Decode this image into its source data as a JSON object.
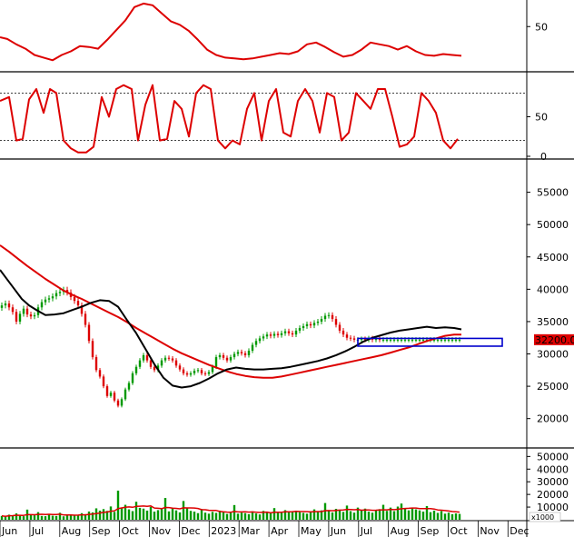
{
  "chart_data": {
    "type": "line",
    "colors": {
      "adx": "#dd0000",
      "stoch": "#dd0000",
      "ma_long": "#dd0000",
      "ma_short": "#000000",
      "up_candle": "#009900",
      "down_candle": "#dd0000",
      "volume": "#009900",
      "support_box": "#0000cc",
      "price_tag_bg": "#dd0000"
    },
    "x_labels": [
      "Jun",
      "Jul",
      "Aug",
      "Sep",
      "Oct",
      "Nov",
      "Dec",
      "2023",
      "Mar",
      "Apr",
      "May",
      "Jun",
      "Jul",
      "Aug",
      "Sep",
      "Oct",
      "Nov",
      "Dec"
    ],
    "indicator_panel": {
      "yticks": [
        50
      ],
      "ylim": [
        0,
        80
      ],
      "x": [
        0,
        8,
        18,
        28,
        38,
        48,
        58,
        68,
        78,
        88,
        98,
        108,
        118,
        128,
        138,
        148,
        158,
        168,
        178,
        188,
        198,
        208,
        218,
        228,
        238,
        248,
        258,
        268,
        278,
        288,
        298,
        308,
        318,
        328,
        338,
        348,
        358,
        368,
        378,
        388,
        398,
        408,
        418,
        428,
        438,
        448,
        458,
        468,
        478,
        488,
        498,
        508
      ],
      "values": [
        38,
        36,
        30,
        25,
        18,
        15,
        12,
        18,
        22,
        28,
        27,
        25,
        35,
        46,
        57,
        72,
        76,
        74,
        65,
        56,
        52,
        45,
        35,
        24,
        18,
        15,
        14,
        13,
        14,
        16,
        18,
        20,
        19,
        22,
        30,
        32,
        27,
        21,
        16,
        18,
        24,
        32,
        30,
        28,
        24,
        28,
        22,
        18,
        17,
        19,
        18,
        17
      ]
    },
    "stochastic_panel": {
      "yticks": [
        0,
        50
      ],
      "ylim": [
        0,
        100
      ],
      "levels": [
        20,
        80
      ],
      "x": [
        0,
        10,
        18,
        25,
        32,
        40,
        48,
        55,
        62,
        70,
        78,
        86,
        95,
        103,
        112,
        120,
        128,
        136,
        145,
        152,
        160,
        168,
        176,
        184,
        192,
        200,
        208,
        216,
        224,
        232,
        240,
        248,
        256,
        264,
        272,
        280,
        288,
        296,
        304,
        312,
        320,
        328,
        336,
        344,
        352,
        360,
        368,
        376,
        384,
        392,
        400,
        408,
        416,
        424,
        432,
        440,
        448,
        456,
        464,
        472,
        480,
        488,
        496,
        504
      ],
      "values": [
        70,
        75,
        20,
        22,
        72,
        85,
        55,
        85,
        80,
        20,
        10,
        5,
        5,
        12,
        75,
        50,
        85,
        90,
        85,
        20,
        65,
        90,
        20,
        22,
        70,
        60,
        25,
        80,
        90,
        85,
        20,
        10,
        20,
        15,
        60,
        80,
        20,
        70,
        85,
        30,
        25,
        70,
        85,
        70,
        30,
        80,
        75,
        20,
        30,
        80,
        70,
        60,
        85,
        85,
        50,
        12,
        15,
        25,
        80,
        70,
        55,
        20,
        10,
        22
      ]
    },
    "price_panel": {
      "yticks": [
        20000,
        25000,
        30000,
        35000,
        40000,
        45000,
        50000,
        55000
      ],
      "ylim": [
        15600,
        60000
      ],
      "last_price_label": "32200.00",
      "support_zone": {
        "x": [
          394,
          553
        ],
        "y": [
          31200,
          32400
        ]
      },
      "candles": {
        "x": [
          2,
          6,
          10,
          14,
          18,
          22,
          26,
          30,
          34,
          38,
          42,
          46,
          50,
          54,
          58,
          62,
          66,
          70,
          74,
          78,
          82,
          86,
          90,
          94,
          98,
          102,
          106,
          110,
          114,
          118,
          122,
          126,
          130,
          134,
          138,
          142,
          146,
          150,
          154,
          158,
          162,
          166,
          170,
          174,
          178,
          182,
          186,
          190,
          194,
          198,
          202,
          206,
          210,
          214,
          218,
          222,
          226,
          230,
          234,
          238,
          242,
          246,
          250,
          254,
          258,
          262,
          266,
          270,
          274,
          278,
          282,
          286,
          290,
          294,
          298,
          302,
          306,
          310,
          314,
          318,
          322,
          326,
          330,
          334,
          338,
          342,
          346,
          350,
          354,
          358,
          362,
          366,
          370,
          374,
          378,
          382,
          386,
          390,
          394,
          398,
          402,
          406,
          410,
          414,
          418,
          422,
          426,
          430,
          434,
          438,
          442,
          446,
          450,
          454,
          458,
          462,
          466,
          470,
          474,
          478,
          482,
          486,
          490,
          494,
          498,
          502,
          506
        ],
        "close": [
          37500,
          37800,
          37200,
          36500,
          35000,
          36200,
          37000,
          36100,
          35800,
          36000,
          37200,
          38000,
          38400,
          38600,
          38900,
          39400,
          39600,
          39900,
          39500,
          38800,
          38200,
          37500,
          36200,
          34500,
          32000,
          29500,
          27500,
          26500,
          25000,
          23500,
          24000,
          22800,
          22000,
          23000,
          24500,
          25500,
          27000,
          28000,
          29000,
          29800,
          29000,
          28000,
          27500,
          28200,
          29000,
          29400,
          29300,
          29000,
          28200,
          27600,
          27000,
          26800,
          27000,
          27400,
          27500,
          27000,
          26900,
          27200,
          28000,
          29500,
          29800,
          29400,
          29000,
          29500,
          30000,
          30300,
          30100,
          29800,
          30500,
          31400,
          32000,
          32400,
          32700,
          33000,
          32800,
          33100,
          32900,
          33200,
          33500,
          33200,
          33000,
          33600,
          34000,
          34300,
          34600,
          34400,
          34800,
          35000,
          35400,
          35900,
          36000,
          35400,
          34500,
          33600,
          33000,
          32500,
          32400,
          32200,
          32200,
          32300,
          32200,
          32400,
          32200,
          32300,
          32200,
          32200,
          32200,
          32200,
          32200,
          32200,
          32200,
          32200,
          32200,
          32200,
          32200,
          32200,
          32200,
          32200,
          32200,
          32200,
          32200,
          32200,
          32200,
          32200,
          32200,
          32200,
          32200
        ]
      },
      "ma_short": {
        "x": [
          0,
          8,
          16,
          24,
          32,
          40,
          50,
          60,
          70,
          80,
          90,
          100,
          110,
          120,
          130,
          140,
          150,
          160,
          170,
          180,
          190,
          200,
          210,
          220,
          230,
          240,
          250,
          260,
          270,
          280,
          290,
          300,
          310,
          320,
          330,
          340,
          350,
          360,
          370,
          380,
          390,
          400,
          410,
          420,
          430,
          440,
          450,
          460,
          470,
          480,
          490,
          500,
          508
        ],
        "values": [
          43000,
          41500,
          40000,
          38500,
          37500,
          36800,
          36000,
          36100,
          36300,
          36800,
          37300,
          37900,
          38300,
          38200,
          37300,
          35200,
          33200,
          30800,
          28400,
          26300,
          25100,
          24800,
          25000,
          25500,
          26200,
          27000,
          27600,
          27900,
          27700,
          27600,
          27600,
          27700,
          27800,
          28000,
          28300,
          28600,
          28900,
          29300,
          29800,
          30400,
          31100,
          31900,
          32500,
          32900,
          33300,
          33600,
          33800,
          34000,
          34200,
          34000,
          34100,
          34000,
          33800
        ]
      },
      "ma_long": {
        "x": [
          0,
          10,
          20,
          30,
          40,
          50,
          60,
          70,
          80,
          90,
          100,
          110,
          120,
          130,
          140,
          150,
          160,
          170,
          180,
          190,
          200,
          210,
          220,
          230,
          240,
          250,
          260,
          270,
          280,
          290,
          300,
          310,
          320,
          330,
          340,
          350,
          360,
          370,
          380,
          390,
          400,
          410,
          420,
          430,
          440,
          450,
          460,
          470,
          480,
          490,
          500,
          508
        ],
        "values": [
          46800,
          45800,
          44700,
          43600,
          42600,
          41600,
          40700,
          39800,
          39100,
          38500,
          37800,
          37100,
          36400,
          35700,
          34900,
          34000,
          33200,
          32400,
          31600,
          30800,
          30100,
          29500,
          28900,
          28300,
          27800,
          27300,
          26900,
          26600,
          26400,
          26300,
          26300,
          26500,
          26800,
          27100,
          27400,
          27700,
          28000,
          28300,
          28600,
          28900,
          29200,
          29500,
          29800,
          30200,
          30600,
          31000,
          31500,
          32000,
          32400,
          32800,
          33000,
          33000
        ]
      }
    },
    "volume_panel": {
      "yticks": [
        10000,
        20000,
        30000,
        40000,
        50000
      ],
      "ylim": [
        0,
        56000
      ],
      "scale_label": "x1000",
      "ma_color": "#dd0000",
      "x": [
        2,
        6,
        10,
        14,
        18,
        22,
        26,
        30,
        34,
        38,
        42,
        46,
        50,
        54,
        58,
        62,
        66,
        70,
        74,
        78,
        82,
        86,
        90,
        94,
        98,
        102,
        106,
        110,
        114,
        118,
        122,
        126,
        130,
        134,
        138,
        142,
        146,
        150,
        154,
        158,
        162,
        166,
        170,
        174,
        178,
        182,
        186,
        190,
        194,
        198,
        202,
        206,
        210,
        214,
        218,
        222,
        226,
        230,
        234,
        238,
        242,
        246,
        250,
        254,
        258,
        262,
        266,
        270,
        274,
        278,
        282,
        286,
        290,
        294,
        298,
        302,
        306,
        310,
        314,
        318,
        322,
        326,
        330,
        334,
        338,
        342,
        346,
        350,
        354,
        358,
        362,
        366,
        370,
        374,
        378,
        382,
        386,
        390,
        394,
        398,
        402,
        406,
        410,
        414,
        418,
        422,
        426,
        430,
        434,
        438,
        442,
        446,
        450,
        454,
        458,
        462,
        466,
        470,
        474,
        478,
        482,
        486,
        490,
        494,
        498,
        502,
        506
      ],
      "values": [
        3000,
        2500,
        4000,
        3500,
        5000,
        3200,
        2800,
        8000,
        4000,
        3500,
        6000,
        3000,
        2800,
        4500,
        3200,
        3000,
        5500,
        2700,
        3400,
        4200,
        3600,
        3800,
        5200,
        4400,
        6500,
        5800,
        9000,
        7200,
        8400,
        7000,
        10500,
        6200,
        23000,
        9600,
        11800,
        8200,
        6800,
        14200,
        9400,
        8800,
        7200,
        10200,
        6400,
        7600,
        8800,
        17200,
        6600,
        9200,
        7400,
        5800,
        14800,
        9200,
        7000,
        6400,
        5200,
        8400,
        5600,
        4800,
        6200,
        5400,
        7200,
        6400,
        4600,
        5400,
        11600,
        4800,
        5600,
        5200,
        4400,
        6600,
        5000,
        4200,
        7000,
        6200,
        5600,
        9200,
        6200,
        5400,
        7600,
        5800,
        6400,
        7200,
        6000,
        5400,
        4800,
        6800,
        8200,
        6600,
        7400,
        13200,
        7000,
        5800,
        8600,
        7400,
        6200,
        11200,
        6800,
        5600,
        9600,
        7200,
        8800,
        6400,
        5600,
        7800,
        8400,
        11800,
        7000,
        9600,
        6800,
        10400,
        12800,
        8800,
        7400,
        9600,
        8200,
        7400,
        6400,
        10800,
        6000,
        7200,
        5400,
        6800,
        4800,
        5600,
        4400,
        5000,
        4600
      ]
    }
  }
}
